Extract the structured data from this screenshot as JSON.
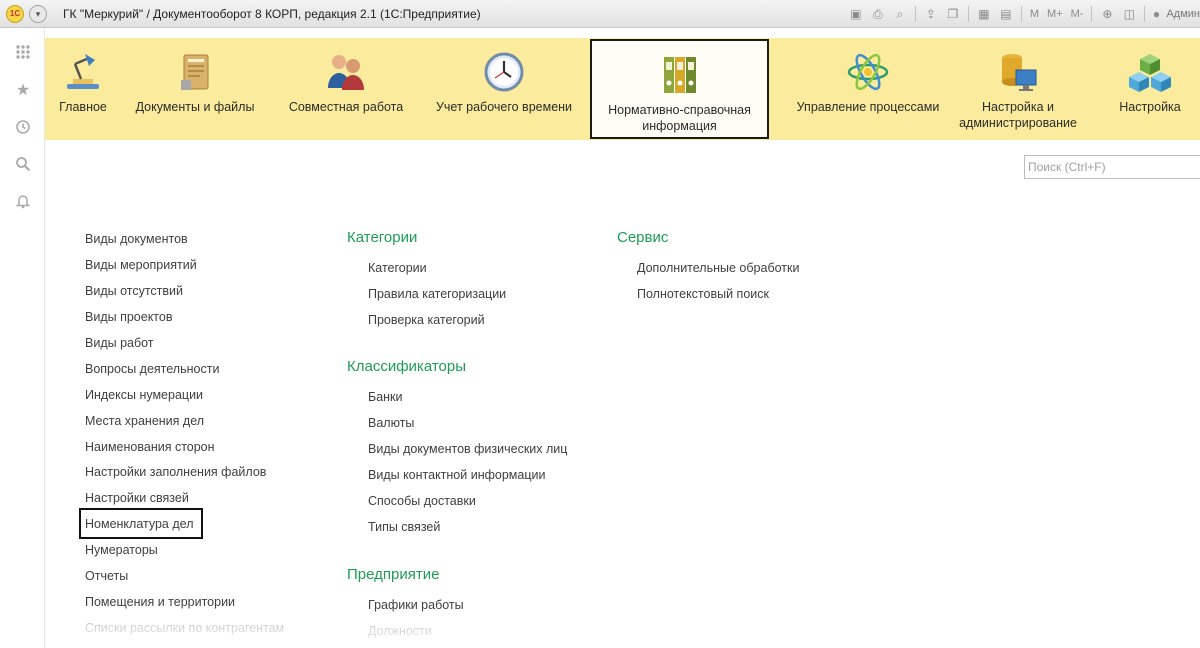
{
  "titlebar": {
    "title": "ГК \"Меркурий\" / Документооборот 8 КОРП, редакция 2.1  (1С:Предприятие)",
    "logo_text": "1С",
    "zoom_labels": [
      "M",
      "M+",
      "M-"
    ],
    "user_label": "Админ"
  },
  "sections": [
    {
      "label": "Главное",
      "icon": "desk-lamp-icon",
      "active": false
    },
    {
      "label": "Документы и файлы",
      "icon": "folder-icon",
      "active": false
    },
    {
      "label": "Совместная работа",
      "icon": "people-icon",
      "active": false
    },
    {
      "label": "Учет рабочего времени",
      "icon": "clock-icon",
      "active": false
    },
    {
      "label": "Нормативно-справочная информация",
      "icon": "binders-icon",
      "active": true
    },
    {
      "label": "Управление процессами",
      "icon": "atom-icon",
      "active": false
    },
    {
      "label": "Настройка и администрирование",
      "icon": "database-computer-icon",
      "active": false
    },
    {
      "label": "Настройка",
      "icon": "cubes-icon",
      "active": false
    }
  ],
  "search": {
    "placeholder": "Поиск (Ctrl+F)"
  },
  "column1": {
    "items": [
      "Виды документов",
      "Виды мероприятий",
      "Виды отсутствий",
      "Виды проектов",
      "Виды работ",
      "Вопросы деятельности",
      "Индексы нумерации",
      "Места хранения дел",
      "Наименования сторон",
      "Настройки заполнения файлов",
      "Настройки связей",
      "Номенклатура дел",
      "Нумераторы",
      "Отчеты",
      "Помещения и территории",
      "Списки рассылки по контрагентам"
    ],
    "highlighted": "Номенклатура дел"
  },
  "column2": {
    "groups": [
      {
        "title": "Категории",
        "items": [
          "Категории",
          "Правила категоризации",
          "Проверка категорий"
        ]
      },
      {
        "title": "Классификаторы",
        "items": [
          "Банки",
          "Валюты",
          "Виды документов физических лиц",
          "Виды контактной информации",
          "Способы доставки",
          "Типы связей"
        ]
      },
      {
        "title": "Предприятие",
        "items": [
          "Графики работы",
          "Должности"
        ]
      }
    ]
  },
  "column3": {
    "groups": [
      {
        "title": "Сервис",
        "items": [
          "Дополнительные обработки",
          "Полнотекстовый поиск"
        ]
      }
    ]
  },
  "colors": {
    "section_bar": "#fbec9d",
    "group_title": "#1f9d55",
    "link": "#404040"
  }
}
